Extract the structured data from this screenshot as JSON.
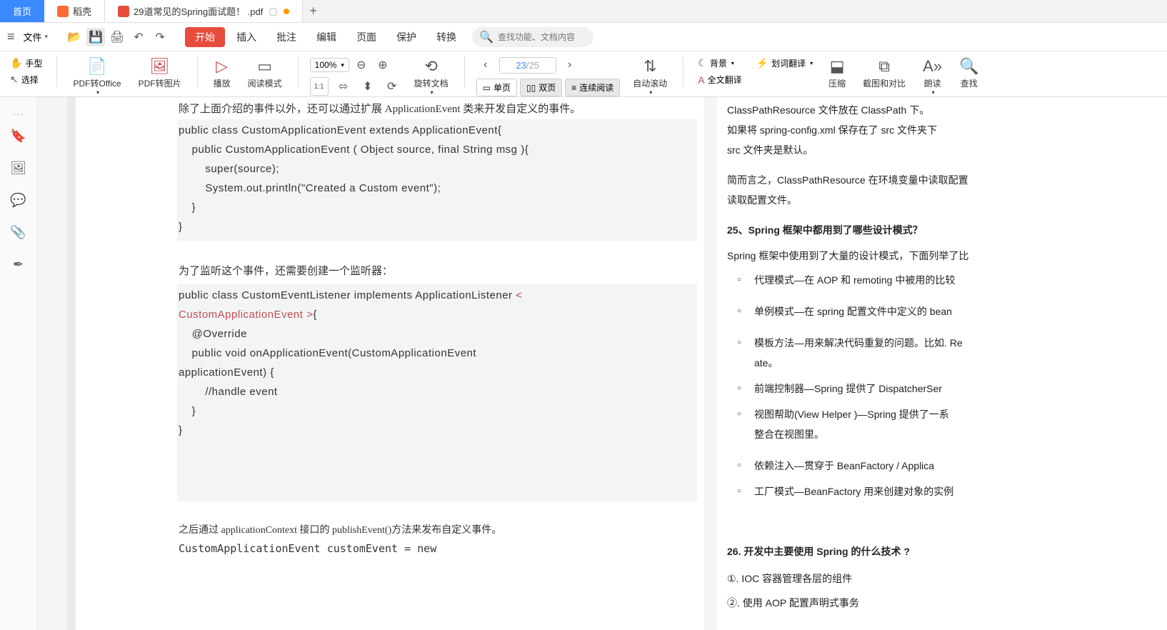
{
  "tabs": {
    "home": "首页",
    "shell": "稻壳",
    "active": "29道常见的Spring面试题！ .pdf"
  },
  "toolbar": {
    "file": "文件",
    "search_placeholder": "查找功能、文档内容"
  },
  "menu": {
    "start": "开始",
    "insert": "插入",
    "annotate": "批注",
    "edit": "编辑",
    "page": "页面",
    "protect": "保护",
    "convert": "转换"
  },
  "ribbon": {
    "hand": "手型",
    "select": "选择",
    "pdf2office": "PDF转Office",
    "pdf2img": "PDF转图片",
    "play": "播放",
    "readmode": "阅读模式",
    "zoom": "100%",
    "rotate": "旋转文档",
    "single": "单页",
    "double": "双页",
    "continuous": "连续阅读",
    "autoscroll": "自动滚动",
    "bg": "背景",
    "dict": "划词翻译",
    "fulltrans": "全文翻译",
    "compress": "压缩",
    "screenshot": "截图和对比",
    "read": "朗读",
    "find": "查找",
    "page_cur": "23",
    "page_tot": "/25"
  },
  "doc": {
    "l1": "除了上面介绍的事件以外，还可以通过扩展 ApplicationEvent 类来开发自定义的事件。",
    "c1_1": "public class CustomApplicationEvent extends ApplicationEvent{",
    "c1_2": "    public CustomApplicationEvent ( Object source, final String msg ){",
    "c1_3": "        super(source);",
    "c1_4": "        System.out.println(\"Created a Custom event\");",
    "c1_5": "    }",
    "c1_6": "}",
    "l2": "为了监听这个事件，还需要创建一个监听器：",
    "c2_1": "public class CustomEventListener implements ApplicationListener ",
    "c2_1b": "<",
    "c2_2a": "CustomApplicationEvent >",
    "c2_2b": "{",
    "c2_3": "    @Override",
    "c2_4": "    public void onApplicationEvent(CustomApplicationEvent",
    "c2_5": "applicationEvent) {",
    "c2_6": "        //handle event",
    "c2_7": "    }",
    "c2_8": "}",
    "l3": "之后通过 applicationContext 接口的 publishEvent()方法来发布自定义事件。",
    "c3_1": "CustomApplicationEvent customEvent = new"
  },
  "right": {
    "r1": "ClassPathResource 文件放在 ClassPath 下。",
    "r2": "如果将 spring-config.xml 保存在了 src 文件夹下",
    "r3": "src 文件夹是默认。",
    "r4": "简而言之，ClassPathResource 在环境变量中读取配置",
    "r5": "读取配置文件。",
    "q25": "25、Spring 框架中都用到了哪些设计模式？",
    "r6": "Spring 框架中使用到了大量的设计模式，下面列举了比",
    "li1": "代理模式—在 AOP 和 remoting 中被用的比较",
    "li2": "单例模式—在 spring 配置文件中定义的 bean",
    "li3": "模板方法—用来解决代码重复的问题。比如. Re",
    "li3b": "ate。",
    "li4": "前端控制器—Spring 提供了 DispatcherSer",
    "li5": "视图帮助(View Helper )—Spring 提供了一系",
    "li5b": "整合在视图里。",
    "li6": "依赖注入—贯穿于 BeanFactory / Applica",
    "li7": "工厂模式—BeanFactory 用来创建对象的实例",
    "q26": "26. 开发中主要使用 Spring 的什么技术 ?",
    "a1": "①. IOC 容器管理各层的组件",
    "a2": "②. 使用 AOP 配置声明式事务"
  }
}
